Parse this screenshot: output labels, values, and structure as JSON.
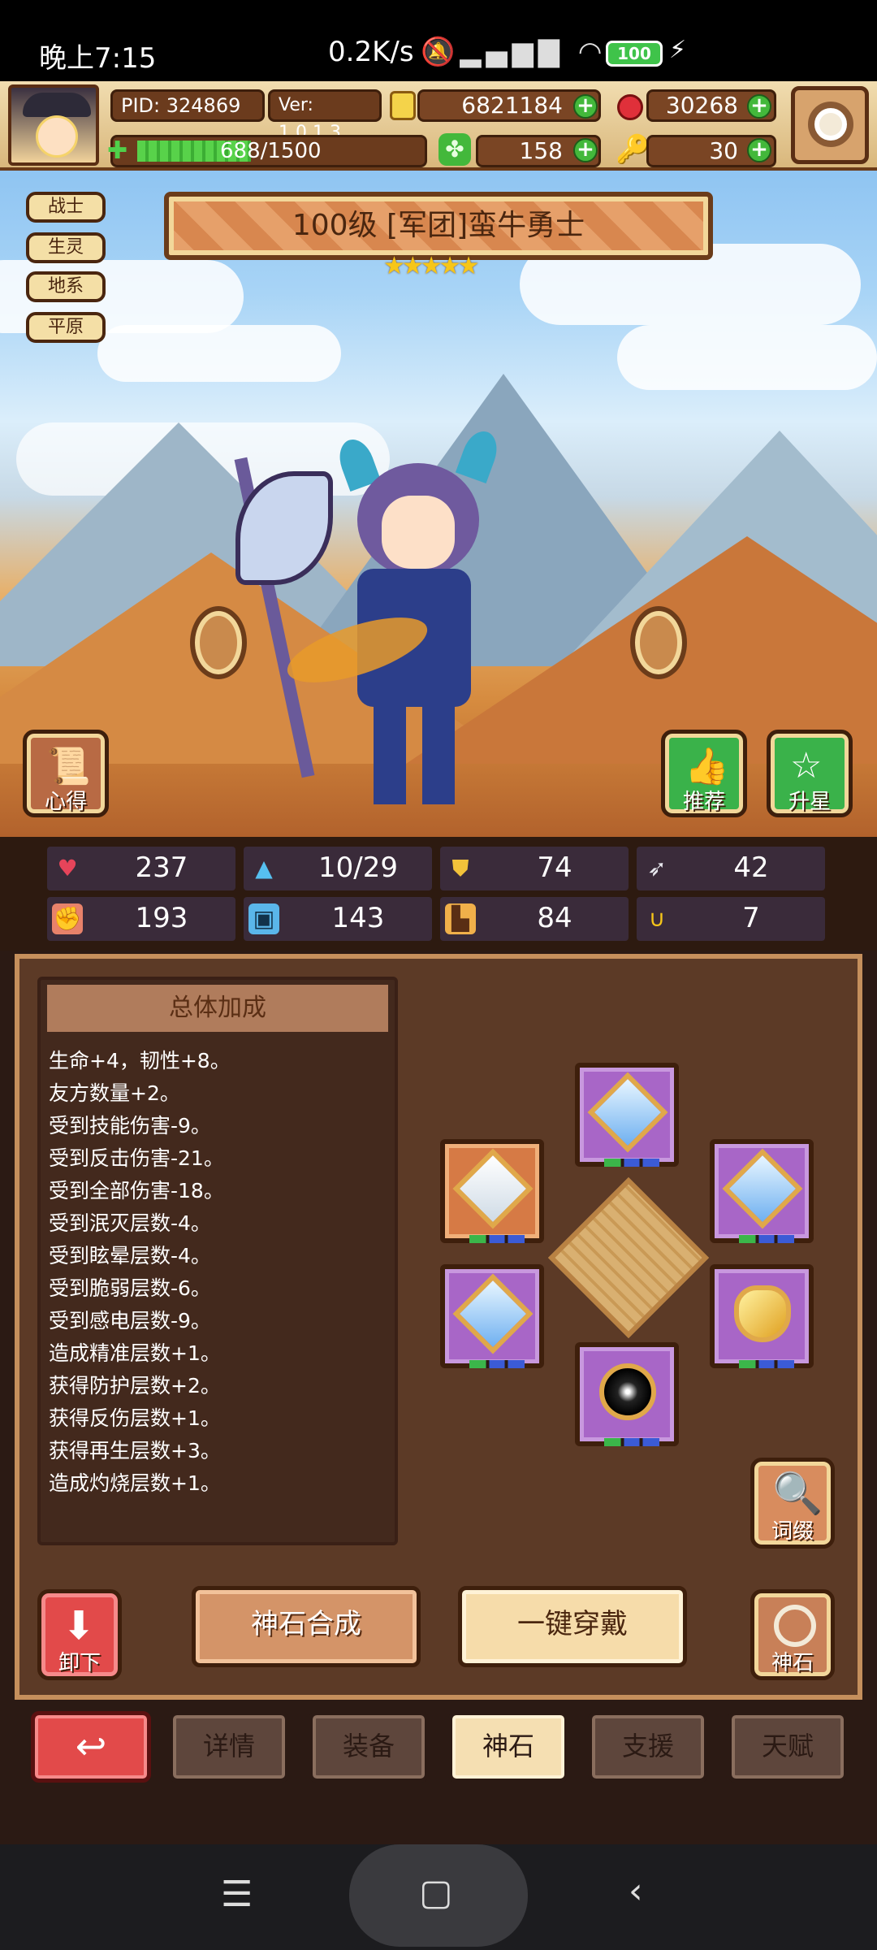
{
  "status_bar": {
    "time": "晚上7:15",
    "net_speed": "0.2K/s",
    "battery": "100"
  },
  "header": {
    "pid": "PID: 324869",
    "version": "Ver: 1.0.1.3",
    "gold": "6821184",
    "gems": "30268",
    "stamina": "688/1500",
    "clover": "158",
    "keys": "30"
  },
  "tags": [
    "战士",
    "生灵",
    "地系",
    "平原"
  ],
  "hero": {
    "title": "100级 [军团]蛮牛勇士",
    "stars": 5
  },
  "buttons": {
    "insight": "心得",
    "recommend": "推荐",
    "upstar": "升星",
    "unequip": "卸下",
    "craft": "神石合成",
    "equip_all": "一键穿戴",
    "divine_stone": "神石",
    "affix": "词缀"
  },
  "stats": [
    {
      "icon": "heart-icon",
      "value": "237",
      "color": "#e6445a"
    },
    {
      "icon": "water-drop-icon",
      "value": "10/29",
      "color": "#56c0f0"
    },
    {
      "icon": "shield-icon",
      "value": "74",
      "color": "#f2c23a"
    },
    {
      "icon": "wing-icon",
      "value": "42",
      "color": "#e8e8ee"
    },
    {
      "icon": "fist-icon",
      "value": "193",
      "color": "#e8826a"
    },
    {
      "icon": "book-icon",
      "value": "143",
      "color": "#5ab6ea"
    },
    {
      "icon": "boot-icon",
      "value": "84",
      "color": "#f0b04a"
    },
    {
      "icon": "horseshoe-icon",
      "value": "7",
      "color": "#f6c619"
    }
  ],
  "bonus": {
    "heading": "总体加成",
    "lines": [
      "生命+4，韧性+8。",
      "友方数量+2。",
      "受到技能伤害-9。",
      "受到反击伤害-21。",
      "受到全部伤害-18。",
      "受到泯灭层数-4。",
      "受到眩晕层数-4。",
      "受到脆弱层数-6。",
      "受到感电层数-9。",
      "造成精准层数+1。",
      "获得防护层数+2。",
      "获得反伤层数+1。",
      "获得再生层数+3。",
      "造成灼烧层数+1。"
    ]
  },
  "tabs": [
    "详情",
    "装备",
    "神石",
    "支援",
    "天赋"
  ],
  "active_tab": "神石"
}
